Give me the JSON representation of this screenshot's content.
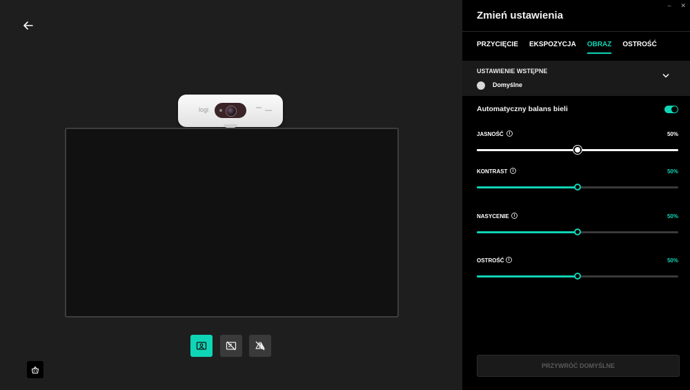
{
  "window": {
    "minimize": "–",
    "close": "✕"
  },
  "panel": {
    "title": "Zmień ustawienia",
    "tabs": [
      {
        "label": "PRZYCIĘCIE",
        "active": false
      },
      {
        "label": "EKSPOZYCJA",
        "active": false
      },
      {
        "label": "OBRAZ",
        "active": true
      },
      {
        "label": "OSTROŚĆ",
        "active": false
      }
    ],
    "preset": {
      "label": "USTAWIENIE WSTĘPNE",
      "value": "Domyślne"
    },
    "auto_white_balance": {
      "label": "Automatyczny balans bieli",
      "enabled": true
    },
    "sliders": [
      {
        "name": "JASNOŚĆ",
        "value_label": "50%",
        "value": 50,
        "style": "white"
      },
      {
        "name": "KONTRAST",
        "value_label": "50%",
        "value": 50,
        "style": "teal"
      },
      {
        "name": "NASYCENIE",
        "value_label": "50%",
        "value": 50,
        "style": "teal"
      },
      {
        "name": "OSTROŚĆ",
        "value_label": "50%",
        "value": 50,
        "style": "teal"
      }
    ],
    "reset_label": "PRZYWRÓĆ DOMYŚLNE"
  },
  "camera": {
    "brand": "logi"
  },
  "colors": {
    "accent": "#0fd5b7",
    "panel_bg": "#000000",
    "main_bg": "#1e1e1e"
  },
  "icons": {
    "back": "arrow-left-icon",
    "preset": "chevron-down-icon",
    "controls": [
      "face-frame-icon",
      "frame-crossed-icon",
      "flip-crossed-icon"
    ],
    "basket": "basket-icon"
  }
}
